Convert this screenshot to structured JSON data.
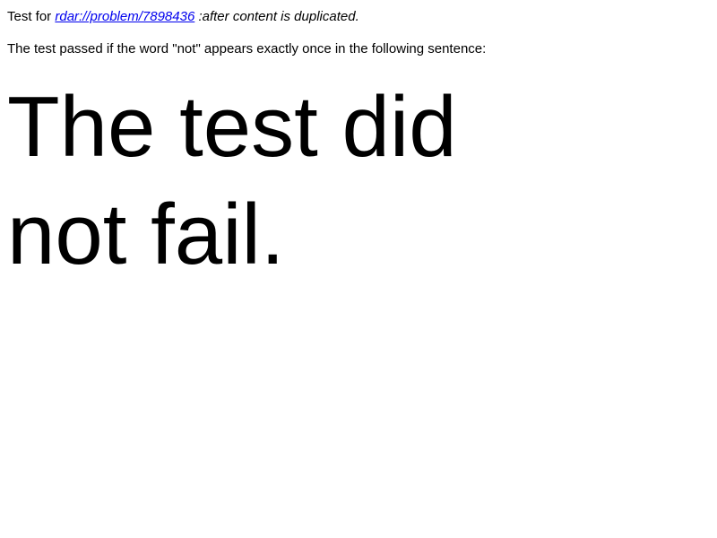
{
  "header": {
    "prefix": "Test for ",
    "link_text": "rdar://problem/7898436",
    "suffix": " :after content is duplicated."
  },
  "instructions": "The test passed if the word \"not\" appears exactly once in the following sentence:",
  "result": {
    "part1": "The test did ",
    "part2": "not fail."
  }
}
